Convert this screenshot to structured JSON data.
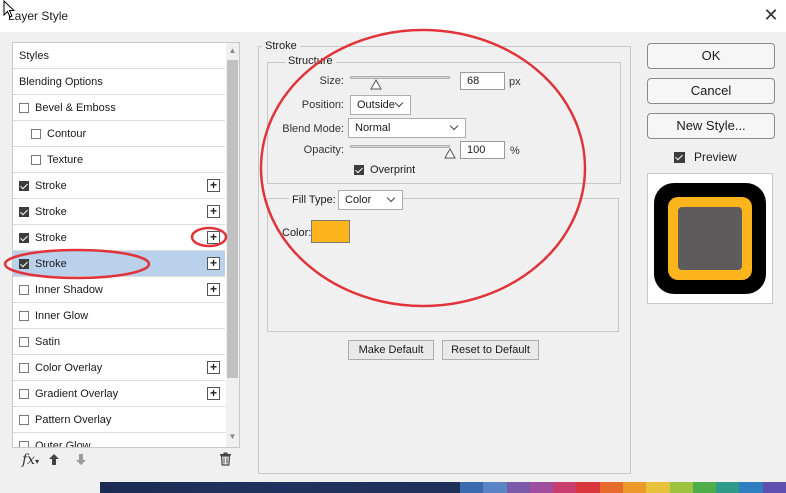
{
  "window": {
    "title": "Layer Style"
  },
  "styles_list": {
    "items": [
      {
        "label": "Styles",
        "checkbox": false,
        "indent": false,
        "plus": false,
        "selected": false
      },
      {
        "label": "Blending Options",
        "checkbox": false,
        "indent": false,
        "plus": false,
        "selected": false
      },
      {
        "label": "Bevel & Emboss",
        "checkbox": true,
        "checked": false,
        "indent": false,
        "plus": false,
        "selected": false
      },
      {
        "label": "Contour",
        "checkbox": true,
        "checked": false,
        "indent": true,
        "plus": false,
        "selected": false
      },
      {
        "label": "Texture",
        "checkbox": true,
        "checked": false,
        "indent": true,
        "plus": false,
        "selected": false
      },
      {
        "label": "Stroke",
        "checkbox": true,
        "checked": true,
        "indent": false,
        "plus": true,
        "selected": false
      },
      {
        "label": "Stroke",
        "checkbox": true,
        "checked": true,
        "indent": false,
        "plus": true,
        "selected": false
      },
      {
        "label": "Stroke",
        "checkbox": true,
        "checked": true,
        "indent": false,
        "plus": true,
        "selected": false
      },
      {
        "label": "Stroke",
        "checkbox": true,
        "checked": true,
        "indent": false,
        "plus": true,
        "selected": true
      },
      {
        "label": "Inner Shadow",
        "checkbox": true,
        "checked": false,
        "indent": false,
        "plus": true,
        "selected": false
      },
      {
        "label": "Inner Glow",
        "checkbox": true,
        "checked": false,
        "indent": false,
        "plus": false,
        "selected": false
      },
      {
        "label": "Satin",
        "checkbox": true,
        "checked": false,
        "indent": false,
        "plus": false,
        "selected": false
      },
      {
        "label": "Color Overlay",
        "checkbox": true,
        "checked": false,
        "indent": false,
        "plus": true,
        "selected": false
      },
      {
        "label": "Gradient Overlay",
        "checkbox": true,
        "checked": false,
        "indent": false,
        "plus": true,
        "selected": false
      },
      {
        "label": "Pattern Overlay",
        "checkbox": true,
        "checked": false,
        "indent": false,
        "plus": false,
        "selected": false
      },
      {
        "label": "Outer Glow",
        "checkbox": true,
        "checked": false,
        "indent": false,
        "plus": false,
        "selected": false
      }
    ],
    "footer": {
      "fx_label": "fx",
      "up_icon": "arrow-up-icon",
      "down_icon": "arrow-down-icon",
      "delete_icon": "trash-icon"
    }
  },
  "stroke": {
    "group_title": "Stroke",
    "structure_title": "Structure",
    "size_label": "Size:",
    "size_value": "68",
    "size_unit": "px",
    "size_slider_fraction": 0.26,
    "position_label": "Position:",
    "position_value": "Outside",
    "blend_mode_label": "Blend Mode:",
    "blend_mode_value": "Normal",
    "opacity_label": "Opacity:",
    "opacity_value": "100",
    "opacity_unit": "%",
    "opacity_slider_fraction": 1.0,
    "overprint_label": "Overprint",
    "overprint_checked": true,
    "fill_type_label": "Fill Type:",
    "fill_type_value": "Color",
    "color_label": "Color:",
    "color_value": "#fbb41b"
  },
  "buttons": {
    "make_default": "Make Default",
    "reset_default": "Reset to Default",
    "ok": "OK",
    "cancel": "Cancel",
    "new_style": "New Style...",
    "preview_label": "Preview",
    "preview_checked": true
  },
  "preview": {
    "outer_color": "#000000",
    "stroke_color": "#fbb41b",
    "fill_color": "#5d5b5c"
  },
  "colors": {
    "selected_row": "#b9d1ea",
    "annotation_red": "#e0343a"
  }
}
